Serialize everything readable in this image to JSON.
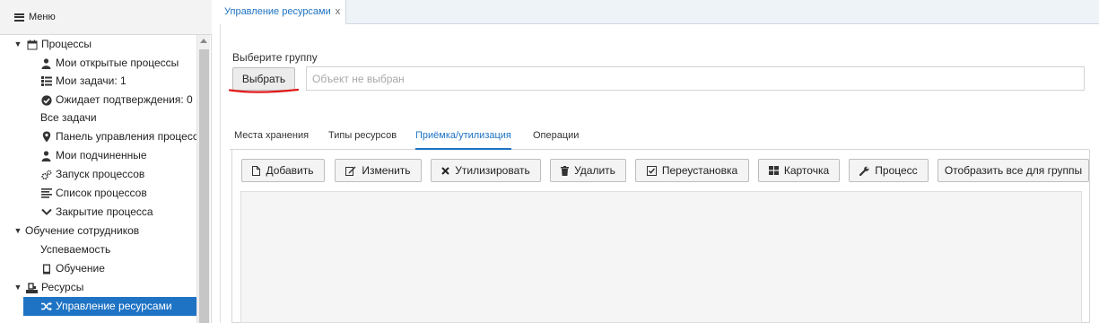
{
  "sidebar": {
    "menu_title": "Меню",
    "items": [
      {
        "label": "Процессы",
        "icon": "calendar-icon",
        "expanded": true
      },
      {
        "label": "Мои открытые процессы",
        "icon": "user-icon"
      },
      {
        "label": "Мои задачи: 1",
        "icon": "list-icon"
      },
      {
        "label": "Ожидает подтверждения: 0",
        "icon": "check-circle-icon"
      },
      {
        "label": "Все задачи",
        "icon": ""
      },
      {
        "label": "Панель управления процессами",
        "icon": "map-marker-icon"
      },
      {
        "label": "Мои подчиненные",
        "icon": "user-icon"
      },
      {
        "label": "Запуск процессов",
        "icon": "cogs-icon"
      },
      {
        "label": "Список процессов",
        "icon": "list-lines-icon"
      },
      {
        "label": "Закрытие процесса",
        "icon": "chevron-down-icon"
      },
      {
        "label": "Обучение сотрудников",
        "icon": "",
        "expanded": true
      },
      {
        "label": "Успеваемость",
        "icon": ""
      },
      {
        "label": "Обучение",
        "icon": "book-icon"
      },
      {
        "label": "Ресурсы",
        "icon": "resources-icon",
        "expanded": true
      },
      {
        "label": "Управление ресурсами",
        "icon": "shuffle-icon",
        "selected": true
      }
    ]
  },
  "tabs": {
    "active_label": "Управление ресурсами",
    "close_symbol": "x"
  },
  "group": {
    "label": "Выберите группу",
    "select_button": "Выбрать",
    "object_placeholder": "Объект не выбран"
  },
  "subtabs": [
    "Места хранения",
    "Типы ресурсов",
    "Приёмка/утилизация",
    "Операции"
  ],
  "active_subtab": "Приёмка/утилизация",
  "toolbar": {
    "add": "Добавить",
    "edit": "Изменить",
    "dispose": "Утилизировать",
    "delete": "Удалить",
    "reinstall": "Переустановка",
    "card": "Карточка",
    "process": "Процесс",
    "show_all": "Отобразить все для группы"
  },
  "colors": {
    "accent": "#1e73c4",
    "annotation": "#e01b1b"
  }
}
